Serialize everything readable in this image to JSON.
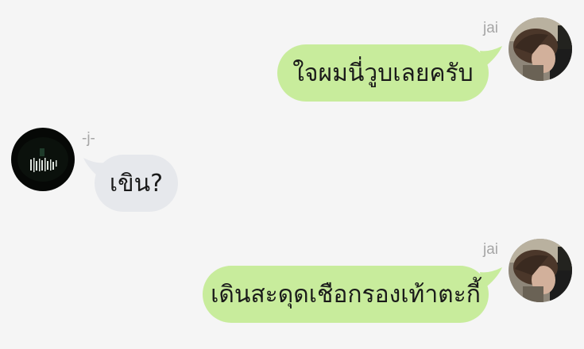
{
  "messages": [
    {
      "side": "right",
      "sender": "jai",
      "text": "ใจผมนี่วูบเลยครับ",
      "avatar": "jai-avatar"
    },
    {
      "side": "left",
      "sender": "-j-",
      "text": "เขิน?",
      "avatar": "j-avatar"
    },
    {
      "side": "right",
      "sender": "jai",
      "text": "เดินสะดุดเชือกรองเท้าตะกี้",
      "avatar": "jai-avatar"
    }
  ],
  "colors": {
    "background": "#f5f5f5",
    "outgoing_bubble": "#c8ec9c",
    "incoming_bubble": "#e6e8ec",
    "name_text": "#a6a6a6"
  }
}
